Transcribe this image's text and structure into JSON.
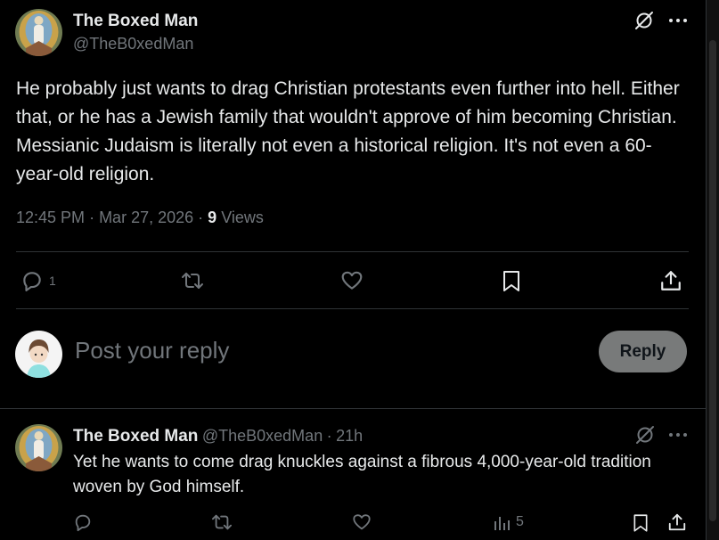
{
  "main_post": {
    "author_name": "The Boxed Man",
    "handle": "@TheB0xedMan",
    "text": "He probably just wants to drag Christian protestants even further into hell. Either that, or he has a Jewish family that wouldn't approve of him becoming Christian. Messianic Judaism is literally not even a historical religion. It's not even a 60-year-old religion.",
    "time": "12:45 PM",
    "date": "Mar 27, 2026",
    "views_count": "9",
    "views_label": "Views",
    "reply_count": "1"
  },
  "composer": {
    "placeholder": "Post your reply",
    "reply_button": "Reply"
  },
  "reply_post": {
    "author_name": "The Boxed Man",
    "handle": "@TheB0xedMan",
    "time_ago": "21h",
    "text": "Yet he wants to come drag knuckles against a fibrous 4,000-year-old tradition woven by God himself.",
    "views_count": "5"
  },
  "icons": [
    "grok-icon",
    "more-icon",
    "reply-icon",
    "repost-icon",
    "like-icon",
    "bookmark-icon",
    "share-icon",
    "views-icon"
  ],
  "colors": {
    "background": "#000000",
    "text": "#e7e9ea",
    "secondary": "#71767b",
    "divider": "#2f3336",
    "reply_button": "#787a7a"
  }
}
